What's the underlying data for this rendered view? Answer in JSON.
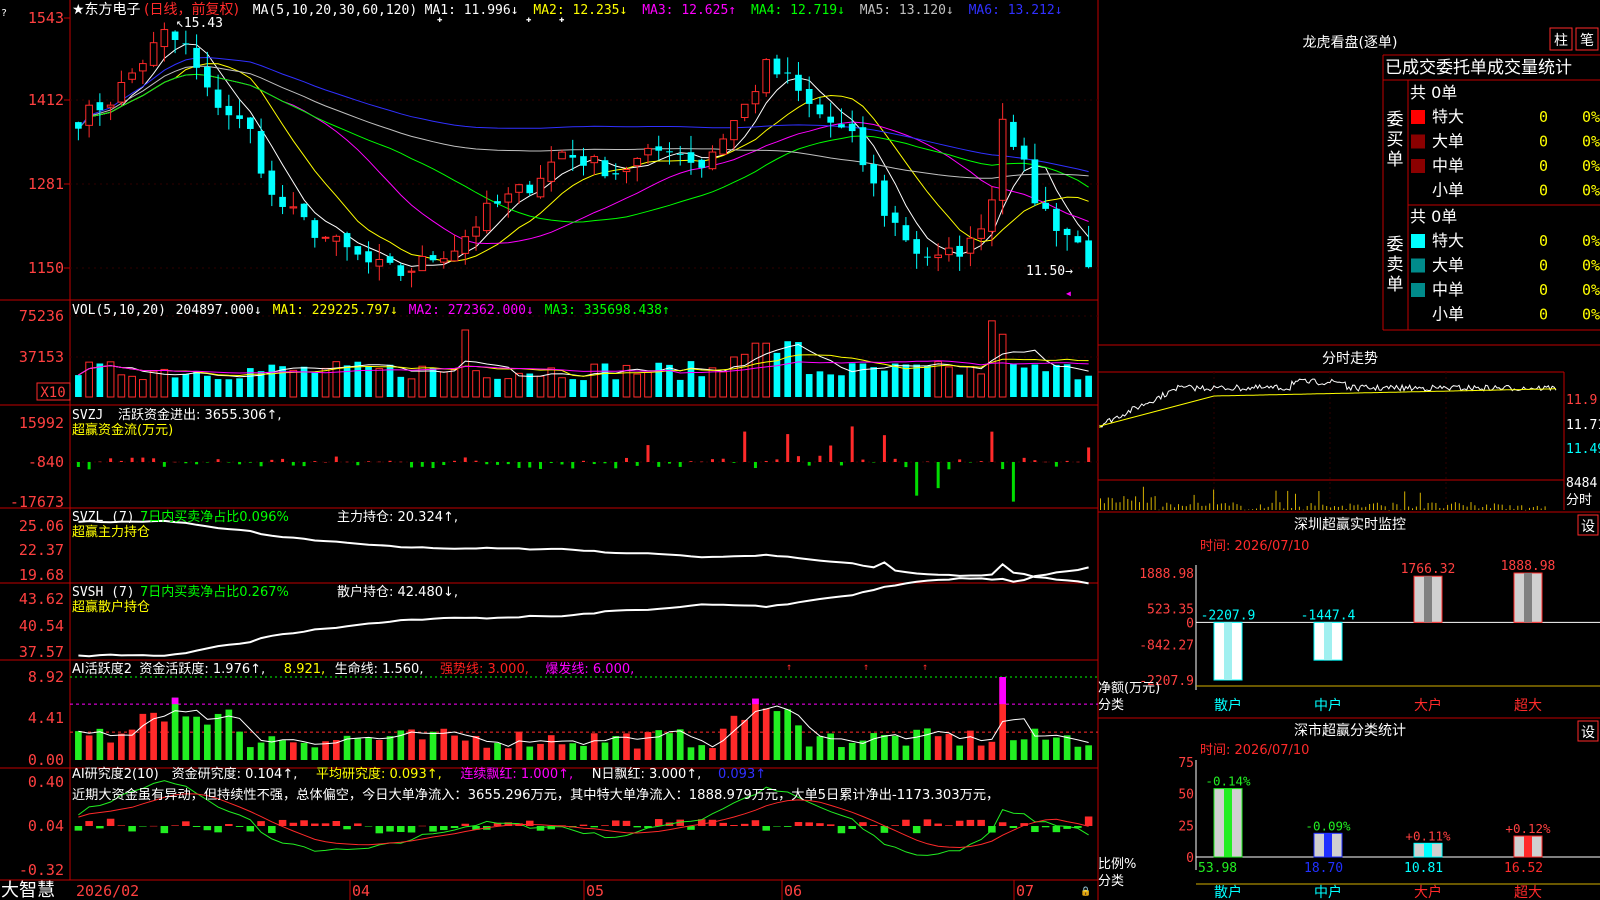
{
  "stock": {
    "name": "★东方电子",
    "period": "(日线，前复权)",
    "ma_label": "MA(5,10,20,30,60,120)",
    "ma_values": [
      {
        "label": "MA1: 11.996↓",
        "color": "#ffffff"
      },
      {
        "label": "MA2: 12.235↓",
        "color": "#ffff00"
      },
      {
        "label": "MA3: 12.625↑",
        "color": "#ff00ff"
      },
      {
        "label": "MA4: 12.719↓",
        "color": "#00ff00"
      },
      {
        "label": "MA5: 13.120↓",
        "color": "#c0c0c0"
      },
      {
        "label": "MA6: 13.212↓",
        "color": "#3030ff"
      }
    ],
    "high_label": "15.43",
    "low_label": "11.50",
    "y_ticks": [
      "1543",
      "1412",
      "1281",
      "1150"
    ],
    "date_labels": [
      "2026/02",
      "04",
      "05",
      "06",
      "07"
    ],
    "logo": "大智慧"
  },
  "vol": {
    "header": "VOL(5,10,20)",
    "items": [
      {
        "label": "204897.000↓",
        "color": "#ffffff"
      },
      {
        "label": "MA1: 229225.797↓",
        "color": "#ffff00"
      },
      {
        "label": "MA2: 272362.000↓",
        "color": "#ff00ff"
      },
      {
        "label": "MA3: 335698.438↑",
        "color": "#00ff00"
      }
    ],
    "y_ticks": [
      "75236",
      "37153"
    ],
    "unit": "X10"
  },
  "svzj": {
    "header": "SVZJ",
    "label": "活跃资金进出: 3655.306↑,",
    "sub": "超赢资金流(万元)",
    "y_ticks": [
      "15992",
      "-840",
      "-17673"
    ]
  },
  "svzl": {
    "header": "SVZL (7)",
    "label_green": "7日内买卖净占比0.096%",
    "label_white": "主力持仓: 20.324↑,",
    "sub": "超赢主力持仓",
    "y_ticks": [
      "25.06",
      "22.37",
      "19.68"
    ]
  },
  "svsh": {
    "header": "SVSH (7)",
    "label_green": "7日内买卖净占比0.267%",
    "label_white": "散户持仓: 42.480↓,",
    "sub": "超赢散户持仓",
    "y_ticks": [
      "43.62",
      "40.54",
      "37.57"
    ]
  },
  "ai1": {
    "header": "AI活跃度2",
    "items": [
      {
        "label": "资金活跃度: 1.976↑,",
        "color": "#ffffff"
      },
      {
        "label": "8.921,",
        "color": "#ffff00"
      },
      {
        "label": "生命线: 1.560,",
        "color": "#ffffff"
      },
      {
        "label": "强势线: 3.000,",
        "color": "#ff2020"
      },
      {
        "label": "爆发线: 6.000,",
        "color": "#ff00ff"
      }
    ],
    "y_ticks": [
      "8.92",
      "4.41",
      "0.00"
    ]
  },
  "ai2": {
    "header": "AI研究度2(10)",
    "items": [
      {
        "label": "资金研究度: 0.104↑,",
        "color": "#ffffff"
      },
      {
        "label": "平均研究度: 0.093↑,",
        "color": "#ffff00"
      },
      {
        "label": "连续飘红: 1.000↑,",
        "color": "#ff00ff"
      },
      {
        "label": "N日飘红: 3.000↑,",
        "color": "#ffffff"
      },
      {
        "label": "0.093↑",
        "color": "#3030ff"
      }
    ],
    "note": "近期大资金虽有异动，但持续性不强，总体偏空，今日大单净流入：3655.296万元，其中特大单净流入：1888.979万元，大单5日累计净出-1173.303万元，",
    "y_ticks": [
      "0.40",
      "0.04",
      "-0.32"
    ]
  },
  "lhb": {
    "title": "龙虎看盘(逐单)",
    "btn_zhu": "柱",
    "btn_bi": "笔",
    "subtitle": "已成交委托单成交量统计",
    "buy_label": "委买单",
    "sell_label": "委卖单",
    "buy_total": "共 0单",
    "sell_total": "共 0单",
    "buy_rows": [
      {
        "name": "特大",
        "count": "0",
        "pct": "0%",
        "color": "#ff0000"
      },
      {
        "name": "大单",
        "count": "0",
        "pct": "0%",
        "color": "#8b0000"
      },
      {
        "name": "中单",
        "count": "0",
        "pct": "0%",
        "color": "#8b0000"
      },
      {
        "name": "小单",
        "count": "0",
        "pct": "0%",
        "color": ""
      }
    ],
    "sell_rows": [
      {
        "name": "特大",
        "count": "0",
        "pct": "0%",
        "color": "#00ffff"
      },
      {
        "name": "大单",
        "count": "0",
        "pct": "0%",
        "color": "#008b8b"
      },
      {
        "name": "中单",
        "count": "0",
        "pct": "0%",
        "color": "#008b8b"
      },
      {
        "name": "小单",
        "count": "0",
        "pct": "0%",
        "color": ""
      }
    ]
  },
  "intraday": {
    "title": "分时走势",
    "y_ticks": [
      "11.9",
      "11.71",
      "11.49"
    ],
    "vol_tick": "8484",
    "vol_unit": "分时"
  },
  "szmon": {
    "title": "深圳超赢实时监控",
    "btn": "设",
    "time": "时间: 2026/07/10",
    "y_ticks": [
      "1888.98",
      "523.35",
      "0",
      "-842.27",
      "-2207.9"
    ],
    "ylabel": "净额(万元)",
    "xlabel": "分类"
  },
  "szstat": {
    "title": "深市超赢分类统计",
    "btn": "设",
    "time": "时间: 2026/07/10",
    "y_ticks": [
      "75",
      "50",
      "25",
      "0"
    ],
    "ylabel": "比例%",
    "xlabel": "分类"
  },
  "chart_data": [
    {
      "type": "bar",
      "title": "深圳超赢实时监控",
      "ylabel": "净额(万元)",
      "xlabel": "分类",
      "categories": [
        "散户",
        "中户",
        "大户",
        "超大"
      ],
      "values": [
        -2207.9,
        -1447.4,
        1766.32,
        1888.98
      ],
      "value_labels": [
        "-2207.9",
        "-1447.4",
        "1766.32",
        "1888.98"
      ],
      "ylim": [
        -2207.9,
        1888.98
      ],
      "grid": false
    },
    {
      "type": "bar",
      "title": "深市超赢分类统计",
      "ylabel": "比例%",
      "xlabel": "分类",
      "categories": [
        "散户",
        "中户",
        "大户",
        "超大"
      ],
      "values": [
        53.98,
        18.7,
        10.81,
        16.52
      ],
      "changes": [
        "-0.14%",
        "-0.09%",
        "+0.11%",
        "+0.12%"
      ],
      "ylim": [
        0,
        75
      ],
      "grid": false
    }
  ]
}
